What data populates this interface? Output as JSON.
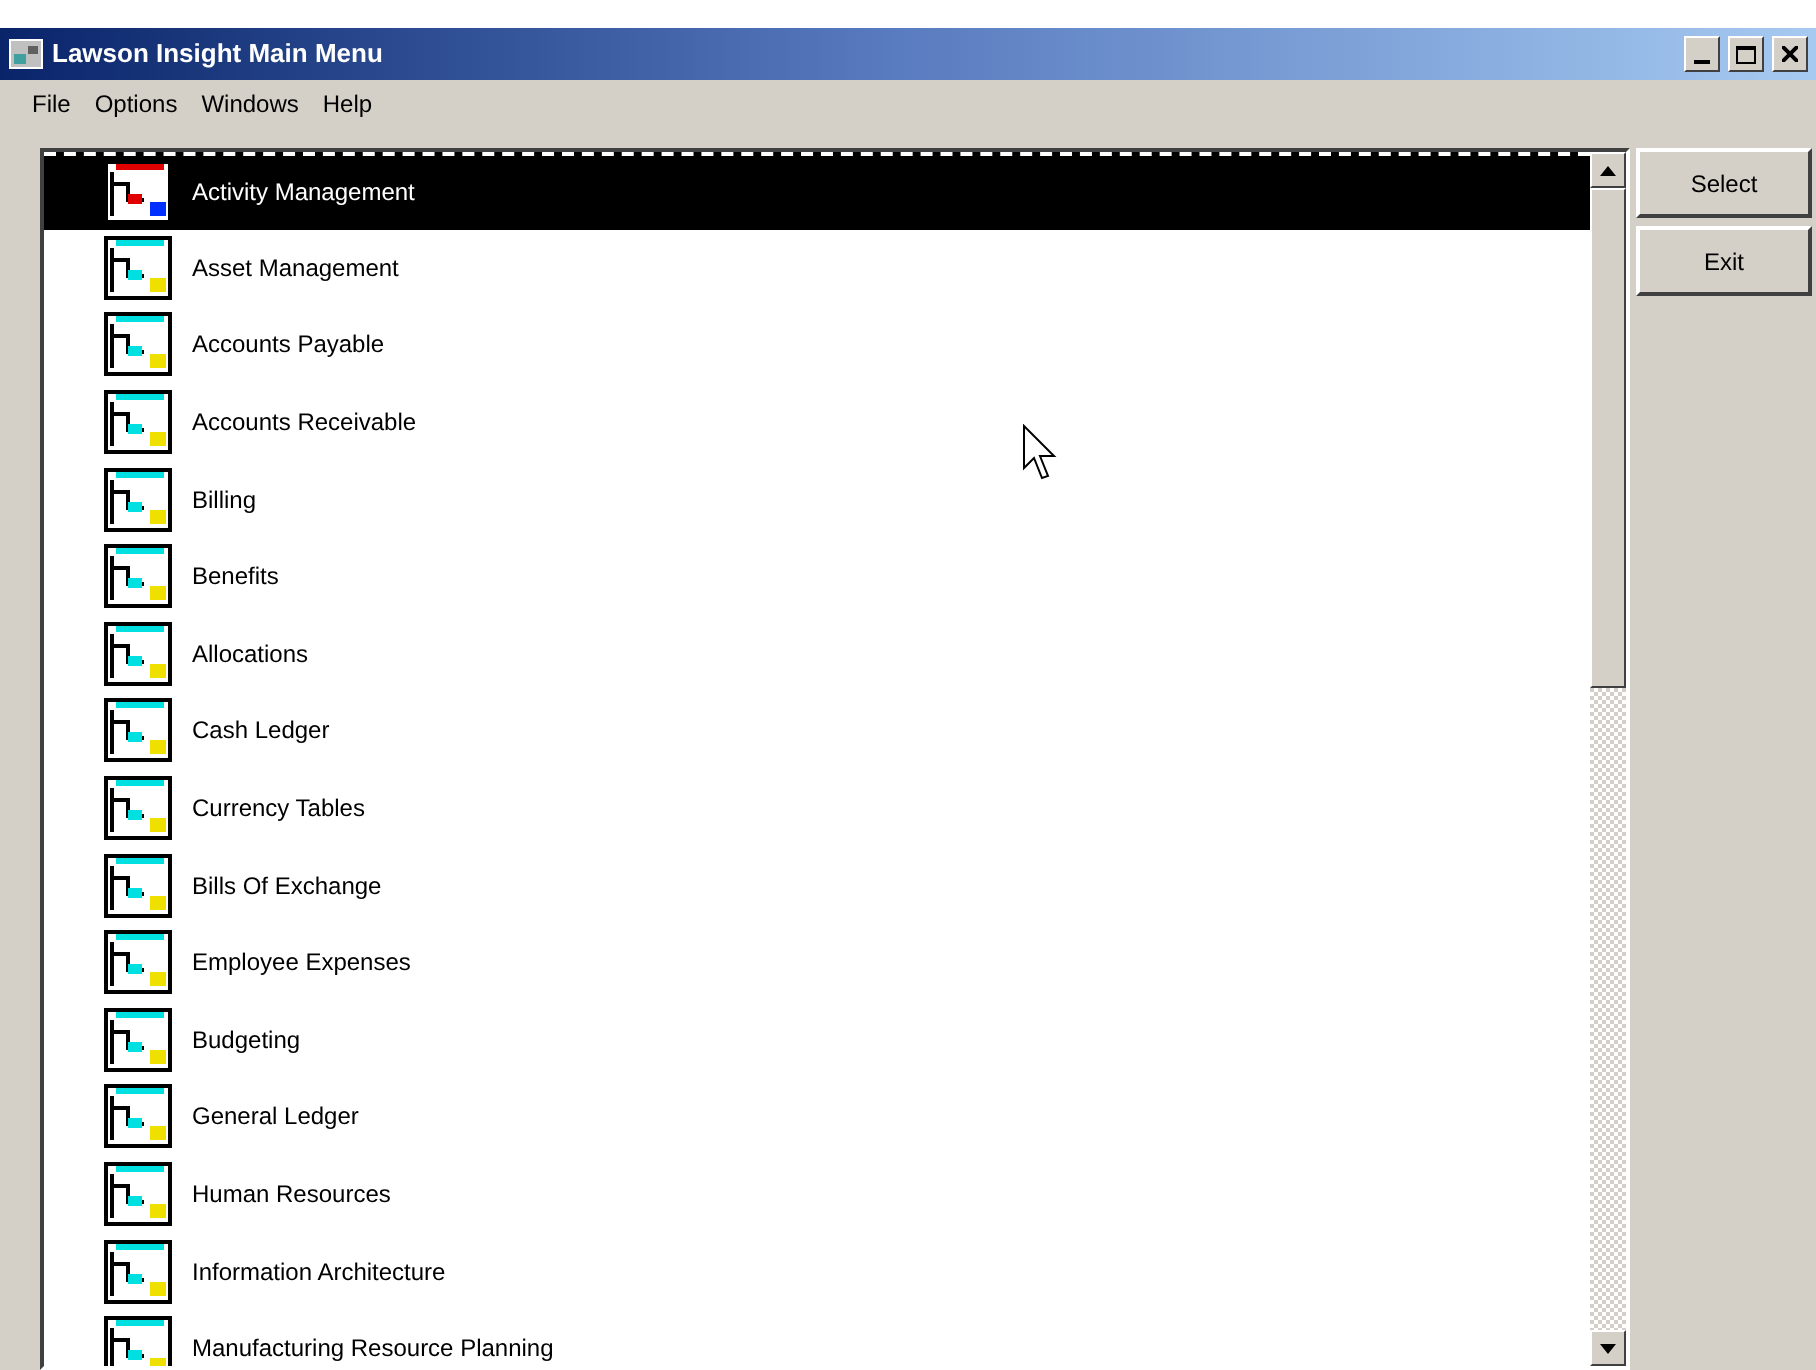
{
  "window": {
    "title": "Lawson Insight Main Menu"
  },
  "menu": [
    "File",
    "Options",
    "Windows",
    "Help"
  ],
  "list": [
    {
      "label": "Activity Management",
      "selected": true
    },
    {
      "label": "Asset Management",
      "selected": false
    },
    {
      "label": "Accounts Payable",
      "selected": false
    },
    {
      "label": "Accounts Receivable",
      "selected": false
    },
    {
      "label": "Billing",
      "selected": false
    },
    {
      "label": "Benefits",
      "selected": false
    },
    {
      "label": "Allocations",
      "selected": false
    },
    {
      "label": "Cash Ledger",
      "selected": false
    },
    {
      "label": "Currency Tables",
      "selected": false
    },
    {
      "label": "Bills Of Exchange",
      "selected": false
    },
    {
      "label": "Employee Expenses",
      "selected": false
    },
    {
      "label": "Budgeting",
      "selected": false
    },
    {
      "label": "General Ledger",
      "selected": false
    },
    {
      "label": "Human Resources",
      "selected": false
    },
    {
      "label": "Information Architecture",
      "selected": false
    },
    {
      "label": "Manufacturing Resource Planning",
      "selected": false
    }
  ],
  "buttons": [
    "Select",
    "Exit"
  ]
}
